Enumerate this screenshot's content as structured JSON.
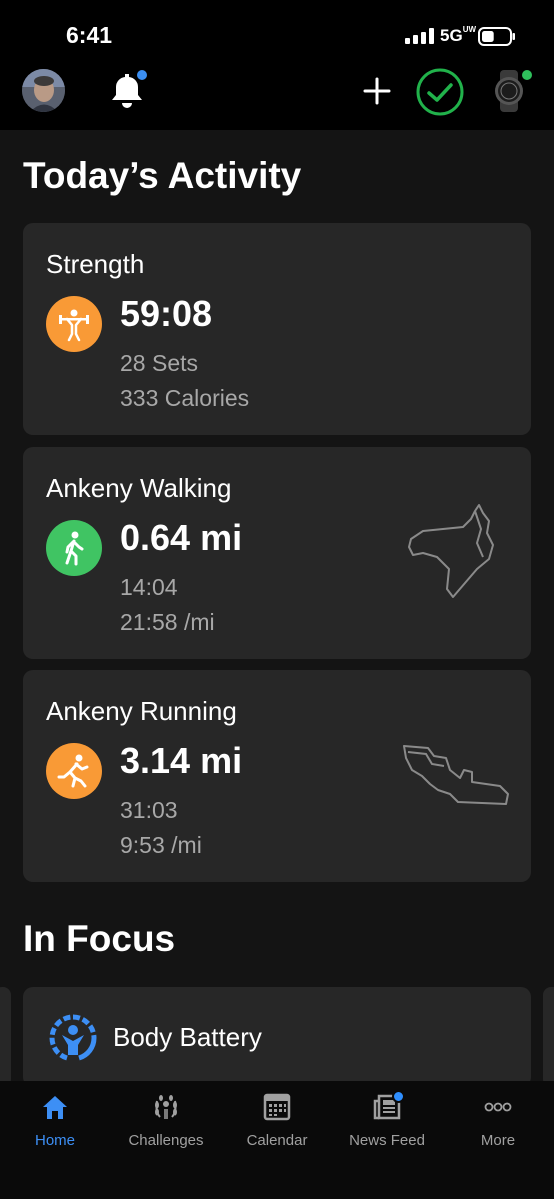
{
  "status_bar": {
    "time": "6:41",
    "network": "5G",
    "network_sub": "UW",
    "battery_level": 0.45
  },
  "top_nav": {
    "notification_dot_color": "#3b8ff3",
    "sync_color": "#21b24b",
    "device_dot_color": "#2fc05c"
  },
  "sections": {
    "today_title": "Today’s Activity",
    "focus_title": "In Focus"
  },
  "activities": [
    {
      "title": "Strength",
      "primary": "59:08",
      "line1": "28 Sets",
      "line2": "333 Calories",
      "icon": "weightlifting-icon",
      "color": "#f99a36"
    },
    {
      "title": "Ankeny Walking",
      "primary": "0.64 mi",
      "line1": "14:04",
      "line2": "21:58 /mi",
      "icon": "walking-icon",
      "color": "#40c463"
    },
    {
      "title": "Ankeny Running",
      "primary": "3.14 mi",
      "line1": "31:03",
      "line2": "9:53 /mi",
      "icon": "running-icon",
      "color": "#f99a36"
    }
  ],
  "focus": {
    "card_label": "Body Battery",
    "icon": "body-battery-icon"
  },
  "tabs": [
    {
      "label": "Home",
      "icon": "home-icon",
      "active": true
    },
    {
      "label": "Challenges",
      "icon": "laurel-icon",
      "active": false
    },
    {
      "label": "Calendar",
      "icon": "calendar-icon",
      "active": false
    },
    {
      "label": "News Feed",
      "icon": "newspaper-icon",
      "active": false
    },
    {
      "label": "More",
      "icon": "more-dots-icon",
      "active": false
    }
  ],
  "colors": {
    "accent_blue": "#3d8ff5",
    "card_bg": "#272727",
    "page_bg": "#141414"
  }
}
